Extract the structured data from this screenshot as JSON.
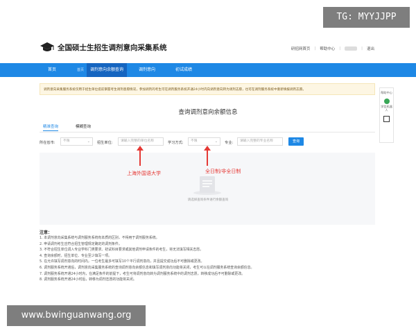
{
  "header": {
    "title": "全国硕士生招生调剂意向采集系统",
    "links": [
      "研招网首页",
      "帮助中心",
      "退出"
    ]
  },
  "nav": {
    "items": [
      "首页",
      "首页",
      "调剂意向余额查询",
      "调剂意向",
      "初试成绩"
    ],
    "active_index": 2
  },
  "notice": "调剂意向采集服务系统仅用于招生单位提前掌握考生调剂意愿情况，参加调剂的考生可在调剂服务系统开通24小时内向调剂意向转为调剂志愿，也可在调剂服务系统中重新填报调剂志愿。",
  "side_tools": [
    "帮助中心",
    "学信机器人",
    "二维码"
  ],
  "page_title": "查询调剂意向余额信息",
  "tabs": [
    "精准查询",
    "模糊查询"
  ],
  "filters": {
    "province_label": "所在省市:",
    "province_value": "不限",
    "unit_label": "招生单位:",
    "unit_placeholder": "请输入完整的单位名称",
    "mode_label": "学习方式:",
    "mode_value": "不限",
    "major_label": "专业:",
    "major_placeholder": "请输入完整的专业名称",
    "query_button": "查询"
  },
  "empty_text": "请选择查询条件进行余额查询",
  "annotations": {
    "unit": "上海外国语大学",
    "mode": "全日制/非全日制"
  },
  "notes_title": "注意：",
  "notes": [
    "1. 本调剂意向采集系统与调剂服务系统有本质的区别，不得用于调剂服务系统。",
    "2. 申请调剂考生应符合招生管理规定确定的调剂条件。",
    "3. 不符合招生单位调入专业学科门类要求、初试科目要求或其他调剂申请条件的考生，将无法填写相关志愿。",
    "4. 查询余额时，招生单位、专业至少填写一项。",
    "5. 在允许填写调剂意向的时间内，一位考生最多可填写10个平行调剂意向，并且提交成功后不可删除或更改。",
    "6. 调剂服务系统开通后，调剂意向采集服务系统的查询调剂意向余额信息和填写调剂意向功能将关闭，考生可以在调剂服务系统查询余额信息。",
    "7. 调剂服务系统开通24小时内，在满足条件的前提下，考生可将调剂意向转为调剂服务系统中的调剂志愿，转移成功后不可删除或更改。",
    "8. 调剂服务系统开通24小时后，转移为调剂志愿的功能将关闭。"
  ],
  "watermarks": {
    "top_right": "TG: MYYJJPP",
    "bottom_left": "www.bwinguanwang.org"
  },
  "colors": {
    "nav_blue": "#1e88e5",
    "annotation_red": "#e53935"
  }
}
